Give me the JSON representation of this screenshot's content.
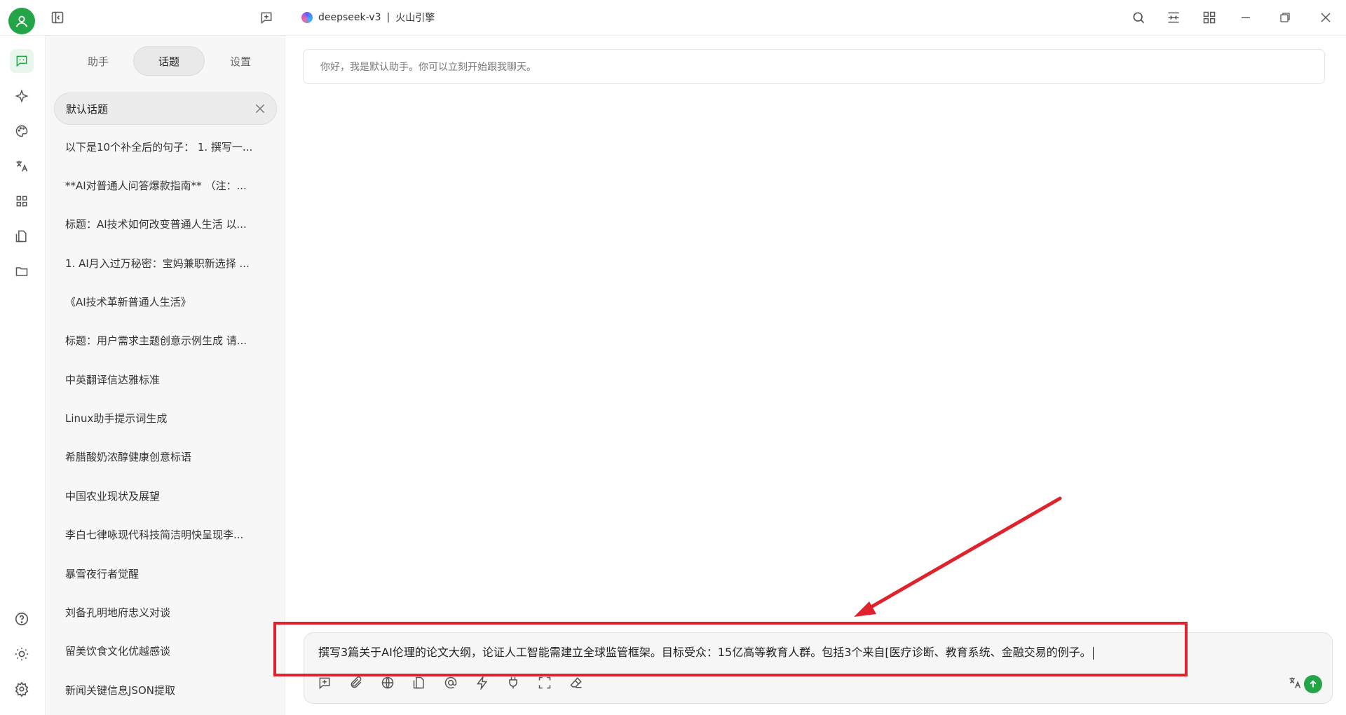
{
  "window": {
    "model_name": "deepseek-v3",
    "separator": "|",
    "provider": "火山引擎"
  },
  "titlebar_icons": [
    "sidebar-toggle-icon",
    "new-topic-icon",
    "search-icon",
    "layout-icon",
    "grid-icon",
    "minimize-icon",
    "restore-icon",
    "close-icon"
  ],
  "rail": {
    "items": [
      "chat-icon",
      "sparkle-icon",
      "palette-icon",
      "translate-icon",
      "apps-icon",
      "files-icon",
      "folder-icon"
    ],
    "bottom": [
      "help-icon",
      "theme-icon",
      "settings-icon"
    ]
  },
  "panel": {
    "tabs": [
      {
        "label": "助手"
      },
      {
        "label": "话题"
      },
      {
        "label": "设置"
      }
    ],
    "active_tab": "话题",
    "default_topic": "默认话题",
    "topics": [
      "以下是10个补全后的句子： 1. 撰写一...",
      "**AI对普通人问答爆款指南** （注：...",
      "标题：AI技术如何改变普通人生活 以...",
      "1. AI月入过万秘密：宝妈兼职新选择 ...",
      "《AI技术革新普通人生活》",
      "标题：用户需求主题创意示例生成 请...",
      "中英翻译信达雅标准",
      "Linux助手提示词生成",
      "希腊酸奶浓醇健康创意标语",
      "中国农业现状及展望",
      "李白七律咏现代科技简洁明快呈现李...",
      "暴雪夜行者觉醒",
      "刘备孔明地府忠义对谈",
      "留美饮食文化优越感谈",
      "新闻关键信息JSON提取"
    ]
  },
  "main": {
    "welcome": "你好，我是默认助手。你可以立刻开始跟我聊天。",
    "input_value": "撰写3篇关于AI伦理的论文大纲，论证人工智能需建立全球监管框架。目标受众：15亿高等教育人群。包括3个来自[医疗诊断、教育系统、金融交易的例子。",
    "input_icons": [
      "new-topic-icon",
      "attachment-icon",
      "web-search-icon",
      "knowledge-icon",
      "mention-icon",
      "quick-phrase-icon",
      "mcp-plug-icon",
      "fullscreen-icon",
      "clear-icon"
    ],
    "translate_icon": "translate-icon",
    "send_icon": "send-icon"
  },
  "colors": {
    "accent": "#22a447",
    "annotation": "#e0222d",
    "panel_bg": "#f7f7f7"
  }
}
